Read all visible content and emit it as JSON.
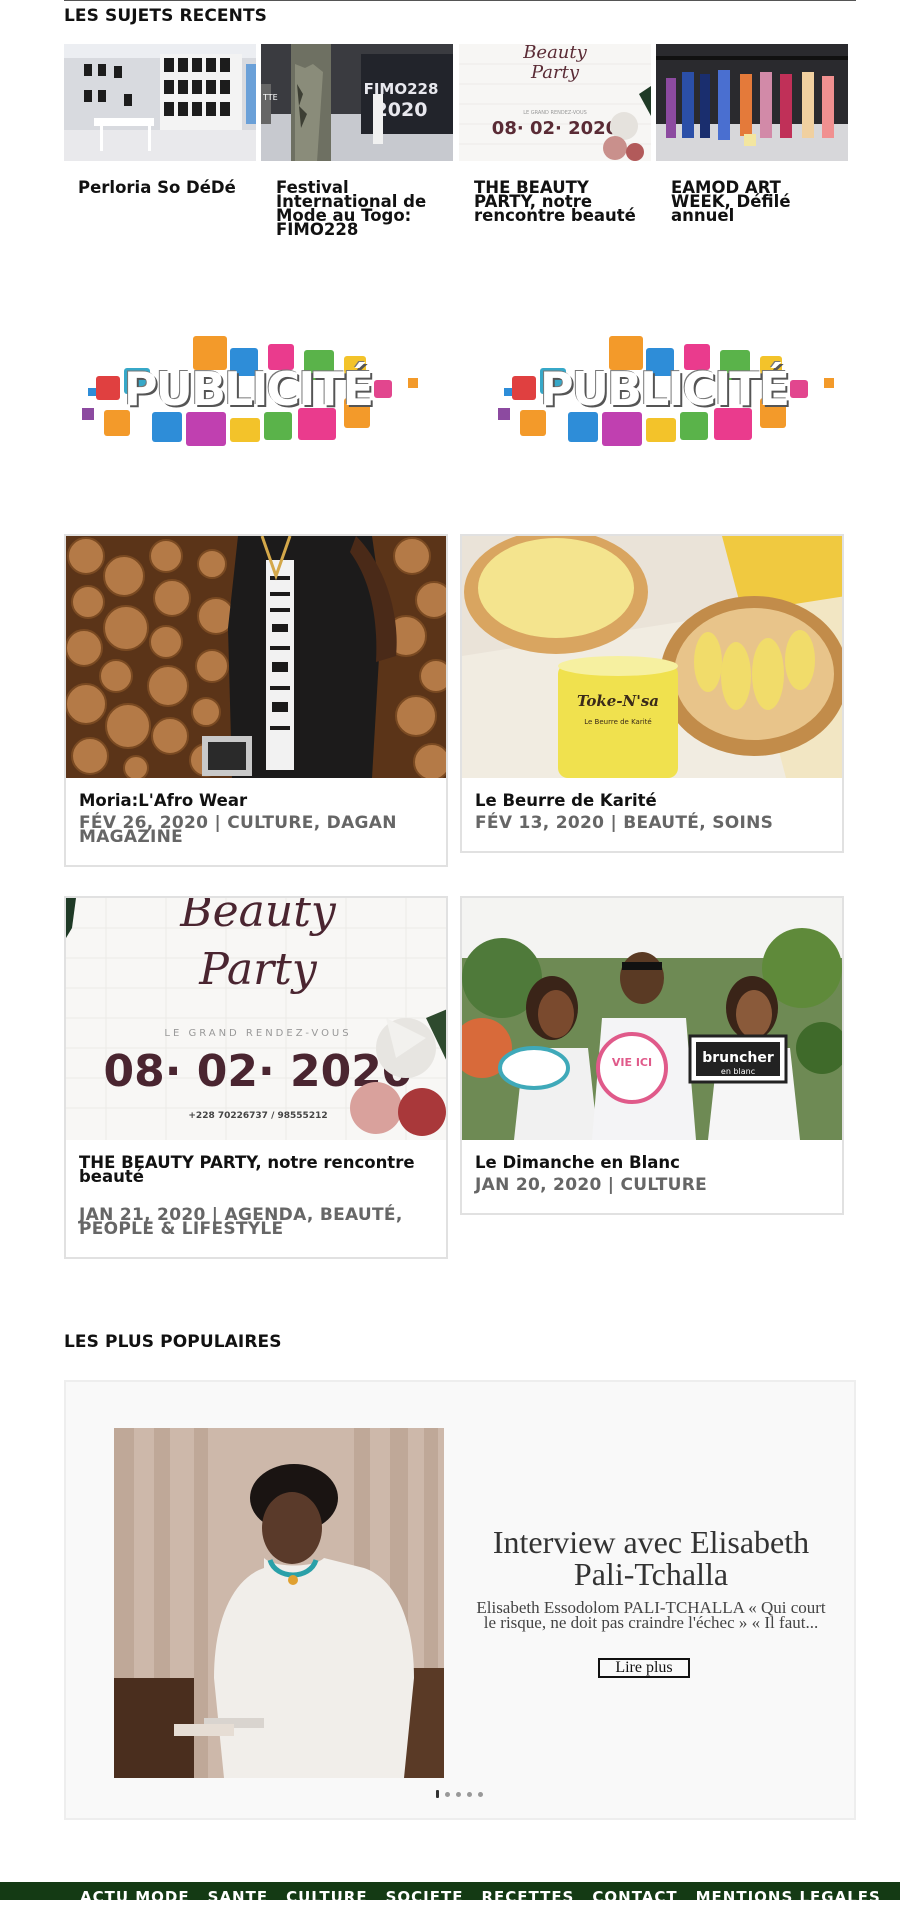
{
  "recent": {
    "title": "LES SUJETS RECENTS",
    "items": [
      {
        "title": "Perloria So DéDé"
      },
      {
        "title": "Festival International de Mode au Togo: FIMO228"
      },
      {
        "title": "THE BEAUTY PARTY, notre rencontre beauté"
      },
      {
        "title": "EAMOD ART WEEK, Défilé annuel"
      }
    ],
    "fimo_text": "FIMO228\n2020",
    "beauty_line1": "Beauty",
    "beauty_line2": "Party",
    "beauty_date": "08· 02· 2020",
    "beauty_sub": "LE GRAND RENDEZ-VOUS"
  },
  "ads": [
    {
      "text": "PUBLICITÉ"
    },
    {
      "text": "PUBLICITÉ"
    }
  ],
  "cards": [
    {
      "title": "Moria:L'Afro Wear",
      "meta": "FÉV 26, 2020 | CULTURE, DAGAN MAGAZINE"
    },
    {
      "title": "Le Beurre de Karité",
      "meta": "FÉV 13, 2020 | BEAUTÉ, SOINS",
      "jar_brand": "Toke-N'sa",
      "jar_label": "Le Beurre de Karité"
    },
    {
      "title": "THE BEAUTY PARTY, notre rencontre beauté",
      "meta": "JAN 21, 2020 | AGENDA, BEAUTÉ, PEOPLE & LIFESTYLE",
      "poster_line1": "Beauty",
      "poster_line2": "Party",
      "poster_sub": "LE GRAND RENDEZ-VOUS",
      "poster_date": "08· 02· 2020",
      "poster_phone": "+228 70226737 / 98555212"
    },
    {
      "title": "Le Dimanche en Blanc",
      "meta": "JAN 20, 2020 | CULTURE",
      "sign1": "VIE ICI",
      "sign2": "bruncher",
      "sign2_sub": "en blanc"
    }
  ],
  "popular": {
    "title": "LES PLUS POPULAIRES",
    "slide_title": "Interview avec Elisabeth Pali-Tchalla",
    "slide_excerpt": "Elisabeth Essodolom PALI-TCHALLA « Qui court le risque, ne doit pas craindre l'échec » « Il faut...",
    "read_more": "Lire plus",
    "dots_count": 5,
    "active_dot": 0
  },
  "footer": {
    "nav": [
      "ACTU MODE",
      "SANTE",
      "CULTURE",
      "SOCIETE",
      "RECETTES",
      "CONTACT",
      "MENTIONS LEGALES"
    ]
  }
}
